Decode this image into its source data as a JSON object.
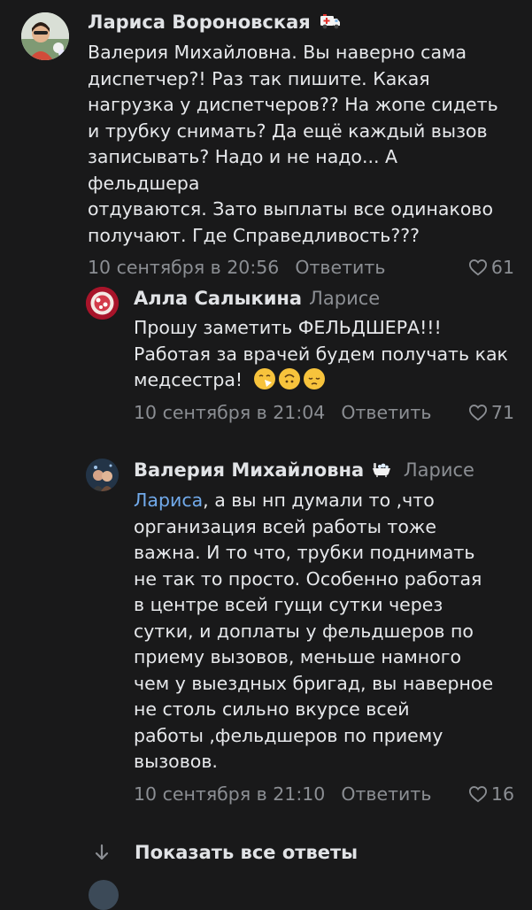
{
  "comments": [
    {
      "author": "Лариса Вороновская",
      "reply_to": "",
      "badge_icon": "ambulance-icon",
      "text_lines": [
        "Валерия Михайловна. Вы наверно сама",
        "диспетчер?! Раз так пишите. Какая",
        "нагрузка у диспетчеров?? На жопе сидеть",
        "и трубку снимать? Да ещё каждый вызов",
        "записывать? Надо и не надо... А фельдшера",
        "отдуваются. Зато выплаты все одинаково",
        "получают. Где Справедливость???"
      ],
      "date": "10 сентября в 20:56",
      "reply_label": "Ответить",
      "likes": "61"
    },
    {
      "author": "Алла Салыкина",
      "reply_to": "Ларисе",
      "text_lines": [
        "Прошу заметить ФЕЛЬДШЕРА!!!",
        "Работая за врачей будем получать как",
        "медсестра!"
      ],
      "emojis": [
        "sneezing-face-icon",
        "upside-down-face-icon",
        "pensive-face-icon"
      ],
      "date": "10 сентября в 21:04",
      "reply_label": "Ответить",
      "likes": "71"
    },
    {
      "author": "Валерия Михайловна",
      "reply_to": "Ларисе",
      "badge_icon": "bathtub-icon",
      "mention": "Лариса",
      "text_lines": [
        ", а вы нп думали то ,что",
        "организация всей работы тоже",
        "важна. И то что, трубки поднимать",
        "не так то просто. Особенно работая",
        "в центре всей гущи сутки через",
        "сутки, и доплаты у фельдшеров по",
        "приему вызовов, меньше намного",
        "чем у выездных бригад, вы наверное",
        "не столь сильно вкурсе всей",
        "работы ,фельдшеров по приему",
        "вызовов."
      ],
      "date": "10 сентября в 21:10",
      "reply_label": "Ответить",
      "likes": "16"
    }
  ],
  "show_all_replies": "Показать все ответы",
  "colors": {
    "background": "#19191a",
    "text": "#e1e3e6",
    "secondary": "#8b8e93",
    "link": "#71aaeb"
  }
}
